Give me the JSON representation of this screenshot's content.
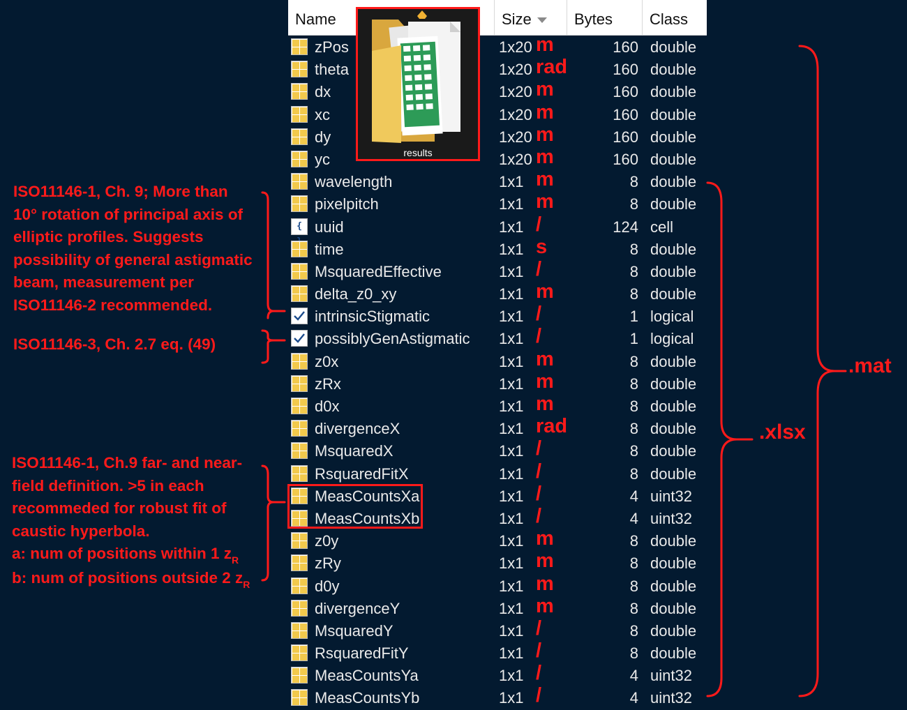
{
  "header": {
    "name_label": "Name",
    "size_label": "Size",
    "bytes_label": "Bytes",
    "class_label": "Class"
  },
  "folder": {
    "caption": "results"
  },
  "rows": [
    {
      "name": "zPos",
      "size": "1x20",
      "unit": "m",
      "bytes": "160",
      "cls": "double",
      "icon": "grid-icon"
    },
    {
      "name": "theta",
      "size": "1x20",
      "unit": "rad",
      "bytes": "160",
      "cls": "double",
      "icon": "grid-icon"
    },
    {
      "name": "dx",
      "size": "1x20",
      "unit": "m",
      "bytes": "160",
      "cls": "double",
      "icon": "grid-icon"
    },
    {
      "name": "xc",
      "size": "1x20",
      "unit": "m",
      "bytes": "160",
      "cls": "double",
      "icon": "grid-icon"
    },
    {
      "name": "dy",
      "size": "1x20",
      "unit": "m",
      "bytes": "160",
      "cls": "double",
      "icon": "grid-icon"
    },
    {
      "name": "yc",
      "size": "1x20",
      "unit": "m",
      "bytes": "160",
      "cls": "double",
      "icon": "grid-icon"
    },
    {
      "name": "wavelength",
      "size": "1x1",
      "unit": "m",
      "bytes": "8",
      "cls": "double",
      "icon": "grid-icon"
    },
    {
      "name": "pixelpitch",
      "size": "1x1",
      "unit": "m",
      "bytes": "8",
      "cls": "double",
      "icon": "grid-icon"
    },
    {
      "name": "uuid",
      "size": "1x1",
      "unit": "/",
      "bytes": "124",
      "cls": "cell",
      "icon": "cell-icon"
    },
    {
      "name": "time",
      "size": "1x1",
      "unit": "s",
      "bytes": "8",
      "cls": "double",
      "icon": "grid-icon"
    },
    {
      "name": "MsquaredEffective",
      "size": "1x1",
      "unit": "/",
      "bytes": "8",
      "cls": "double",
      "icon": "grid-icon"
    },
    {
      "name": "delta_z0_xy",
      "size": "1x1",
      "unit": "m",
      "bytes": "8",
      "cls": "double",
      "icon": "grid-icon"
    },
    {
      "name": "intrinsicStigmatic",
      "size": "1x1",
      "unit": "/",
      "bytes": "1",
      "cls": "logical",
      "icon": "check-icon"
    },
    {
      "name": "possiblyGenAstigmatic",
      "size": "1x1",
      "unit": "/",
      "bytes": "1",
      "cls": "logical",
      "icon": "check-icon"
    },
    {
      "name": "z0x",
      "size": "1x1",
      "unit": "m",
      "bytes": "8",
      "cls": "double",
      "icon": "grid-icon"
    },
    {
      "name": "zRx",
      "size": "1x1",
      "unit": "m",
      "bytes": "8",
      "cls": "double",
      "icon": "grid-icon"
    },
    {
      "name": "d0x",
      "size": "1x1",
      "unit": "m",
      "bytes": "8",
      "cls": "double",
      "icon": "grid-icon"
    },
    {
      "name": "divergenceX",
      "size": "1x1",
      "unit": "rad",
      "bytes": "8",
      "cls": "double",
      "icon": "grid-icon"
    },
    {
      "name": "MsquaredX",
      "size": "1x1",
      "unit": "/",
      "bytes": "8",
      "cls": "double",
      "icon": "grid-icon"
    },
    {
      "name": "RsquaredFitX",
      "size": "1x1",
      "unit": "/",
      "bytes": "8",
      "cls": "double",
      "icon": "grid-icon"
    },
    {
      "name": "MeasCountsXa",
      "size": "1x1",
      "unit": "/",
      "bytes": "4",
      "cls": "uint32",
      "icon": "grid-icon"
    },
    {
      "name": "MeasCountsXb",
      "size": "1x1",
      "unit": "/",
      "bytes": "4",
      "cls": "uint32",
      "icon": "grid-icon"
    },
    {
      "name": "z0y",
      "size": "1x1",
      "unit": "m",
      "bytes": "8",
      "cls": "double",
      "icon": "grid-icon"
    },
    {
      "name": "zRy",
      "size": "1x1",
      "unit": "m",
      "bytes": "8",
      "cls": "double",
      "icon": "grid-icon"
    },
    {
      "name": "d0y",
      "size": "1x1",
      "unit": "m",
      "bytes": "8",
      "cls": "double",
      "icon": "grid-icon"
    },
    {
      "name": "divergenceY",
      "size": "1x1",
      "unit": "m",
      "bytes": "8",
      "cls": "double",
      "icon": "grid-icon"
    },
    {
      "name": "MsquaredY",
      "size": "1x1",
      "unit": "/",
      "bytes": "8",
      "cls": "double",
      "icon": "grid-icon"
    },
    {
      "name": "RsquaredFitY",
      "size": "1x1",
      "unit": "/",
      "bytes": "8",
      "cls": "double",
      "icon": "grid-icon"
    },
    {
      "name": "MeasCountsYa",
      "size": "1x1",
      "unit": "/",
      "bytes": "4",
      "cls": "uint32",
      "icon": "grid-icon"
    },
    {
      "name": "MeasCountsYb",
      "size": "1x1",
      "unit": "/",
      "bytes": "4",
      "cls": "uint32",
      "icon": "grid-icon"
    }
  ],
  "annotations": {
    "note_a": [
      "ISO11146-1, Ch. 9; More than",
      "10° rotation of principal axis of",
      "elliptic profiles. Suggests",
      "possibility of general astigmatic",
      "beam, measurement per",
      "ISO11146-2 recommended."
    ],
    "note_b": "ISO11146-3, Ch. 2.7 eq. (49)",
    "note_c": [
      "ISO11146-1, Ch.9 far- and near-",
      "field definition. >5 in each",
      "recommeded for robust fit of",
      "caustic hyperbola."
    ],
    "note_c_a_text": "a: num of positions within 1 z",
    "note_c_b_text": "b: num of positions outside 2 z",
    "subscript": "R",
    "mat_label": ".mat",
    "xlsx_label": ".xlsx"
  },
  "colors": {
    "background": "#031a30",
    "annotation": "#ff1a1a",
    "header_bg": "#ffffff",
    "text": "#eaeaea"
  }
}
